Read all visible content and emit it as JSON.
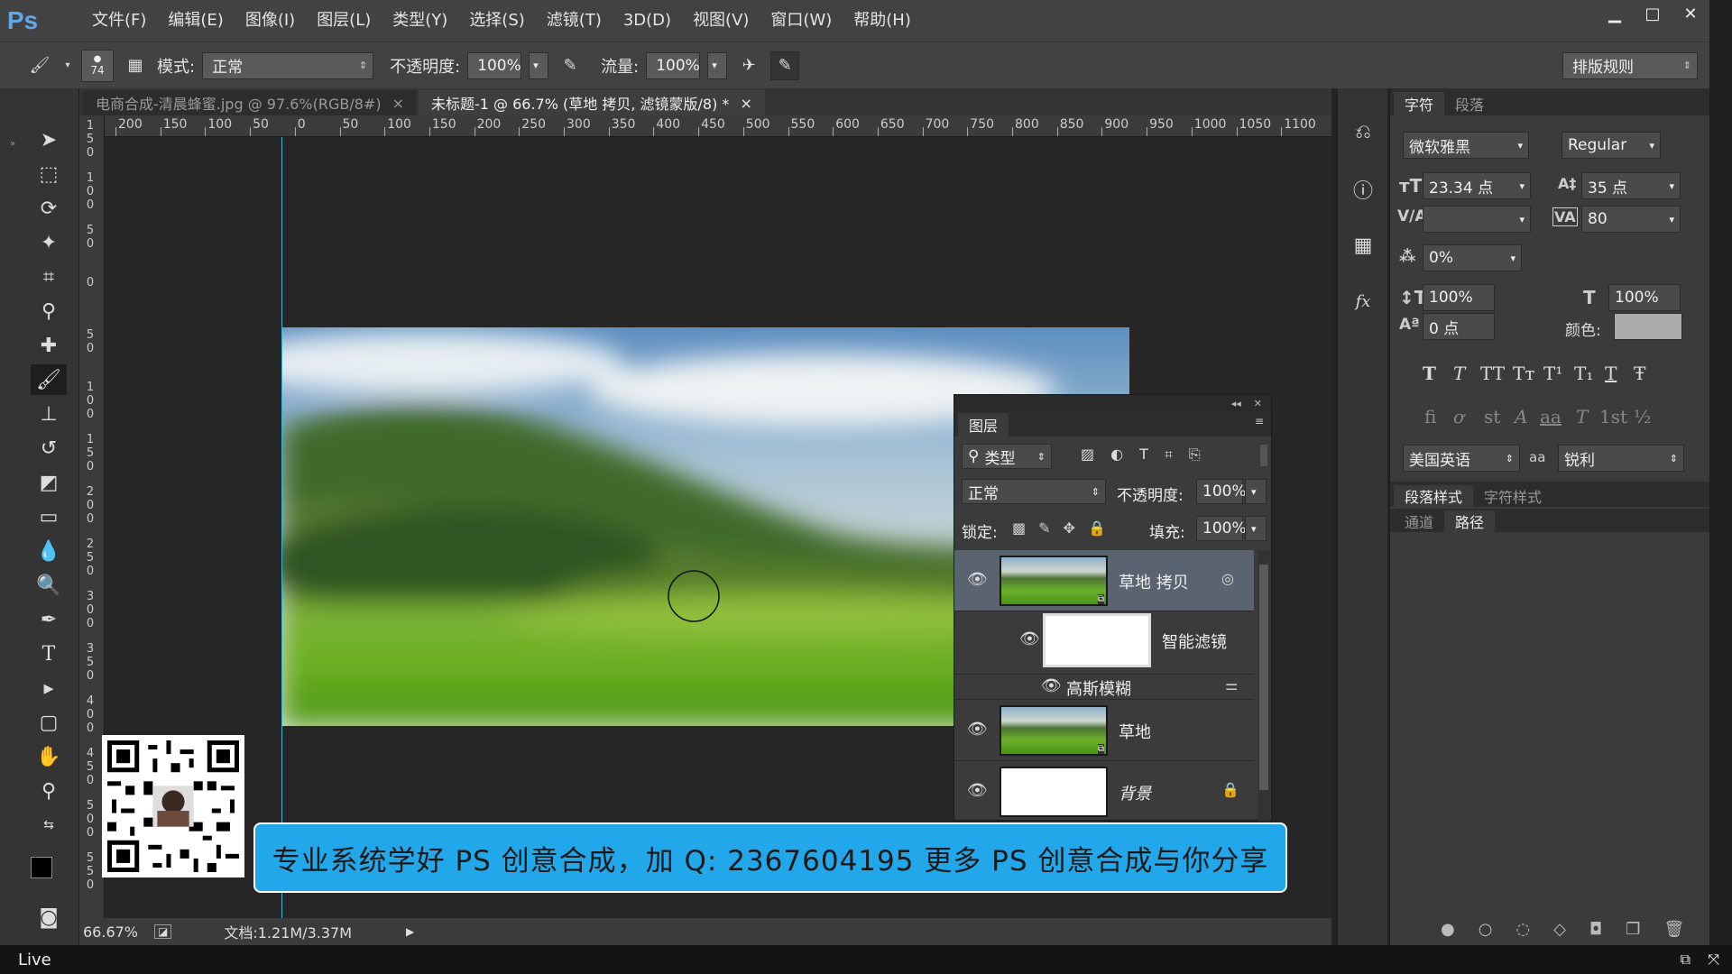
{
  "app": {
    "logo": "Ps"
  },
  "menu": [
    "文件(F)",
    "编辑(E)",
    "图像(I)",
    "图层(L)",
    "类型(Y)",
    "选择(S)",
    "滤镜(T)",
    "3D(D)",
    "视图(V)",
    "窗口(W)",
    "帮助(H)"
  ],
  "options": {
    "brush_size": "74",
    "mode_label": "模式:",
    "mode_value": "正常",
    "opacity_label": "不透明度:",
    "opacity_value": "100%",
    "flow_label": "流量:",
    "flow_value": "100%",
    "workspace": "排版规则"
  },
  "tabs": [
    {
      "label": "电商合成-清晨蜂蜜.jpg @ 97.6%(RGB/8#)",
      "active": false
    },
    {
      "label": "未标题-1 @ 66.7% (草地 拷贝, 滤镜蒙版/8) *",
      "active": true
    }
  ],
  "ruler": {
    "h": [
      "200",
      "150",
      "100",
      "50",
      "0",
      "50",
      "100",
      "150",
      "200",
      "250",
      "300",
      "350",
      "400",
      "450",
      "500",
      "550",
      "600",
      "650",
      "700",
      "750",
      "800",
      "850",
      "900",
      "950",
      "1000",
      "1050",
      "1100"
    ],
    "v": [
      "1\n5\n0",
      "1\n0\n0",
      "5\n0",
      "0",
      "5\n0",
      "1\n0\n0",
      "1\n5\n0",
      "2\n0\n0",
      "2\n5\n0",
      "3\n0\n0",
      "3\n5\n0",
      "4\n0\n0",
      "4\n5\n0",
      "5\n0\n0",
      "5\n5\n0"
    ]
  },
  "status": {
    "zoom": "66.67%",
    "doc": "文档:1.21M/3.37M"
  },
  "layers_panel": {
    "title": "图层",
    "filter_label": "类型",
    "blend": "正常",
    "opacity_label": "不透明度:",
    "opacity": "100%",
    "lock_label": "锁定:",
    "fill_label": "填充:",
    "fill": "100%",
    "layers": [
      {
        "name": "草地 拷贝"
      },
      {
        "name": "智能滤镜"
      },
      {
        "name": "高斯模糊"
      },
      {
        "name": "草地"
      },
      {
        "name": "背景"
      }
    ]
  },
  "character": {
    "tabs": [
      "字符",
      "段落"
    ],
    "font_family": "微软雅黑",
    "font_style": "Regular",
    "size": "23.34 点",
    "leading": "35 点",
    "tracking": "80",
    "scale_pct": "0%",
    "vscale": "100%",
    "hscale": "100%",
    "baseline": "0 点",
    "color_label": "颜色:",
    "language": "美国英语",
    "aa_label": "aa",
    "antialias": "锐利",
    "style_buttons": [
      "T",
      "T",
      "TT",
      "Tт",
      "T¹",
      "T₁",
      "T",
      "Ŧ"
    ],
    "ot_buttons": [
      "fi",
      "ơ",
      "st",
      "A",
      "aa",
      "T",
      "1st",
      "½"
    ],
    "lower_tabs1": [
      "段落样式",
      "字符样式"
    ],
    "lower_tabs2": [
      "通道",
      "路径"
    ]
  },
  "banner": "专业系统学好 PS 创意合成，加 Q: 2367604195  更多 PS 创意合成与你分享",
  "taskbar": {
    "label": "Live"
  },
  "colors": {
    "accent": "#21a7ea",
    "guide": "#3fb4d6"
  }
}
